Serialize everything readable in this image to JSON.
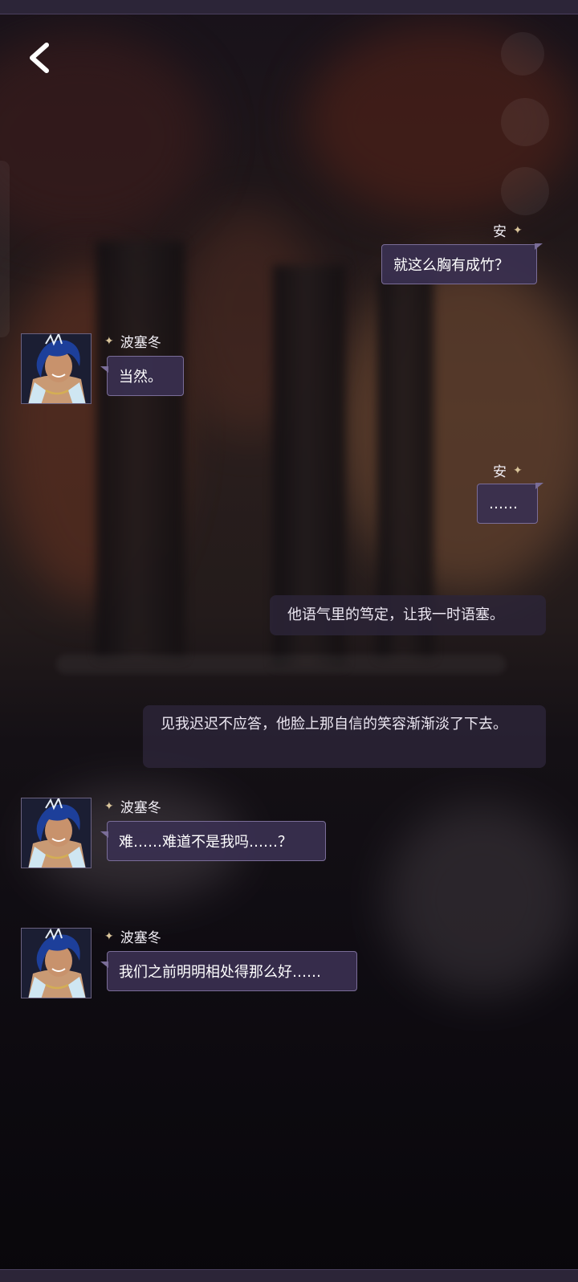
{
  "nav": {
    "back_icon": "chevron-left-icon"
  },
  "messages": [
    {
      "type": "player",
      "speaker": "安",
      "text": "就这么胸有成竹？"
    },
    {
      "type": "npc",
      "speaker": "波塞冬",
      "text": "当然。"
    },
    {
      "type": "player",
      "speaker": "安",
      "text": "……"
    },
    {
      "type": "narration",
      "text": "他语气里的笃定，让我一时语塞。"
    },
    {
      "type": "narration",
      "text": "见我迟迟不应答，他脸上那自信的笑容渐渐淡了下去。"
    },
    {
      "type": "npc",
      "speaker": "波塞冬",
      "text": "难……难道不是我吗……？"
    },
    {
      "type": "npc",
      "speaker": "波塞冬",
      "text": "我们之前明明相处得那么好……"
    }
  ],
  "colors": {
    "bubble_fill": "#3a3050",
    "bubble_border": "#7a6d98",
    "sparkle": "#d9c49a",
    "frame_bar": "#2c2538"
  }
}
